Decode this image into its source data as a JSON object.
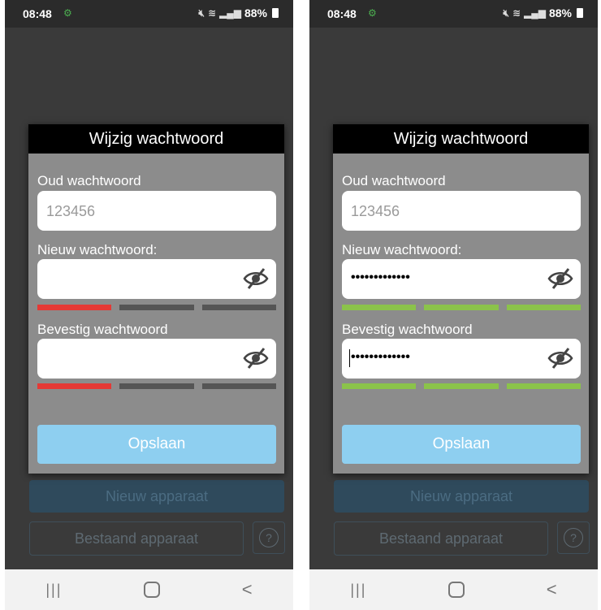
{
  "colors": {
    "weak": "#e53935",
    "strong": "#8bc34a",
    "empty": "#555555"
  },
  "screens": [
    {
      "status_bar": {
        "time": "08:48",
        "battery": "88%"
      },
      "dialog": {
        "title": "Wijzig wachtwoord",
        "old_password": {
          "label": "Oud wachtwoord",
          "placeholder": "123456"
        },
        "new_password": {
          "label": "Nieuw wachtwoord:",
          "value": "",
          "strength": [
            "weak",
            "empty",
            "empty"
          ]
        },
        "confirm_password": {
          "label": "Bevestig wachtwoord",
          "value": "",
          "strength": [
            "weak",
            "empty",
            "empty"
          ]
        },
        "save_label": "Opslaan"
      },
      "background": {
        "new_device_label": "Nieuw apparaat",
        "existing_device_label": "Bestaand apparaat",
        "help_icon": "?"
      },
      "nav_bar": {
        "recent": "|||",
        "back": "<"
      }
    },
    {
      "status_bar": {
        "time": "08:48",
        "battery": "88%"
      },
      "dialog": {
        "title": "Wijzig wachtwoord",
        "old_password": {
          "label": "Oud wachtwoord",
          "placeholder": "123456"
        },
        "new_password": {
          "label": "Nieuw wachtwoord:",
          "value": "•••••••••••••",
          "strength": [
            "strong",
            "strong",
            "strong"
          ]
        },
        "confirm_password": {
          "label": "Bevestig wachtwoord",
          "value": "•••••••••••••",
          "strength": [
            "strong",
            "strong",
            "strong"
          ]
        },
        "save_label": "Opslaan"
      },
      "background": {
        "new_device_label": "Nieuw apparaat",
        "existing_device_label": "Bestaand apparaat",
        "help_icon": "?"
      },
      "nav_bar": {
        "recent": "|||",
        "back": "<"
      }
    }
  ]
}
